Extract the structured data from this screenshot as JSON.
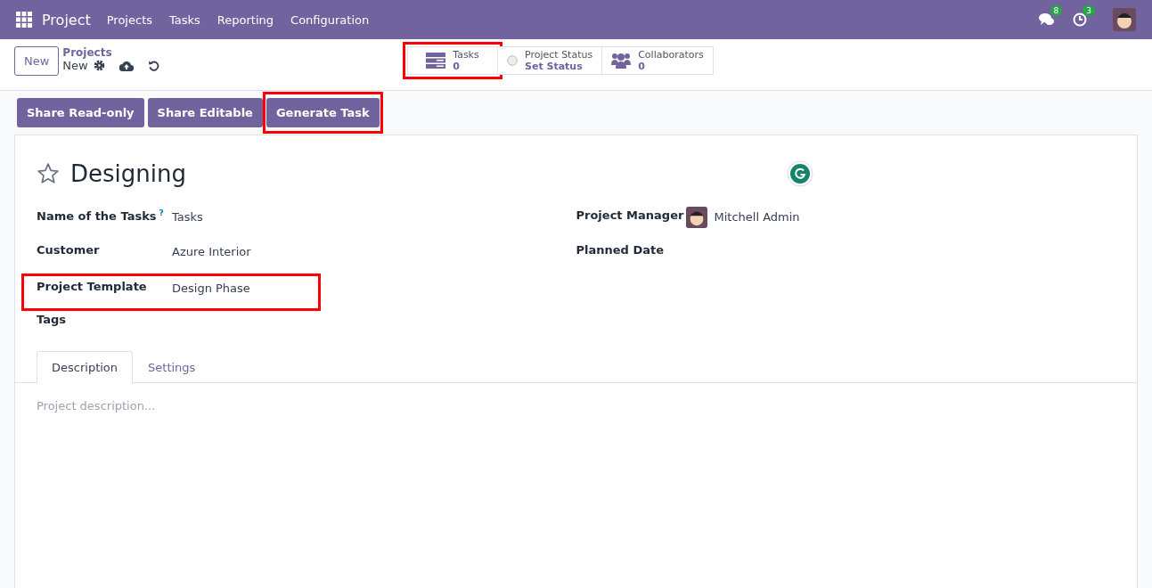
{
  "navbar": {
    "app_name": "Project",
    "menu": [
      "Projects",
      "Tasks",
      "Reporting",
      "Configuration"
    ],
    "messages_badge": "8",
    "activities_badge": "3"
  },
  "control_panel": {
    "new_button": "New",
    "breadcrumb_parent": "Projects",
    "breadcrumb_current": "New"
  },
  "stat_buttons": [
    {
      "kind": "tasks",
      "label": "Tasks",
      "value": "0",
      "highlighted": true
    },
    {
      "kind": "status",
      "label": "Project Status",
      "value": "Set Status",
      "highlighted": false
    },
    {
      "kind": "collaborators",
      "label": "Collaborators",
      "value": "0",
      "highlighted": false
    }
  ],
  "action_buttons": [
    {
      "label": "Share Read-only",
      "highlighted": false
    },
    {
      "label": "Share Editable",
      "highlighted": false
    },
    {
      "label": "Generate Task",
      "highlighted": true
    }
  ],
  "form": {
    "title": "Designing",
    "favorite": false,
    "left_fields": [
      {
        "label": "Name of the Tasks",
        "help": "?",
        "value": "Tasks",
        "highlighted": false
      },
      {
        "label": "Customer",
        "value": "Azure Interior",
        "highlighted": false
      },
      {
        "label": "Project Template",
        "value": "Design Phase",
        "highlighted": true
      },
      {
        "label": "Tags",
        "highlighted": false
      }
    ],
    "right_fields": [
      {
        "label": "Project Manager",
        "value": "Mitchell Admin",
        "avatar": true
      },
      {
        "label": "Planned Date",
        "avatar": false
      }
    ],
    "tabs": [
      {
        "label": "Description",
        "selected": true
      },
      {
        "label": "Settings",
        "selected": false
      }
    ],
    "description_placeholder": "Project description..."
  }
}
